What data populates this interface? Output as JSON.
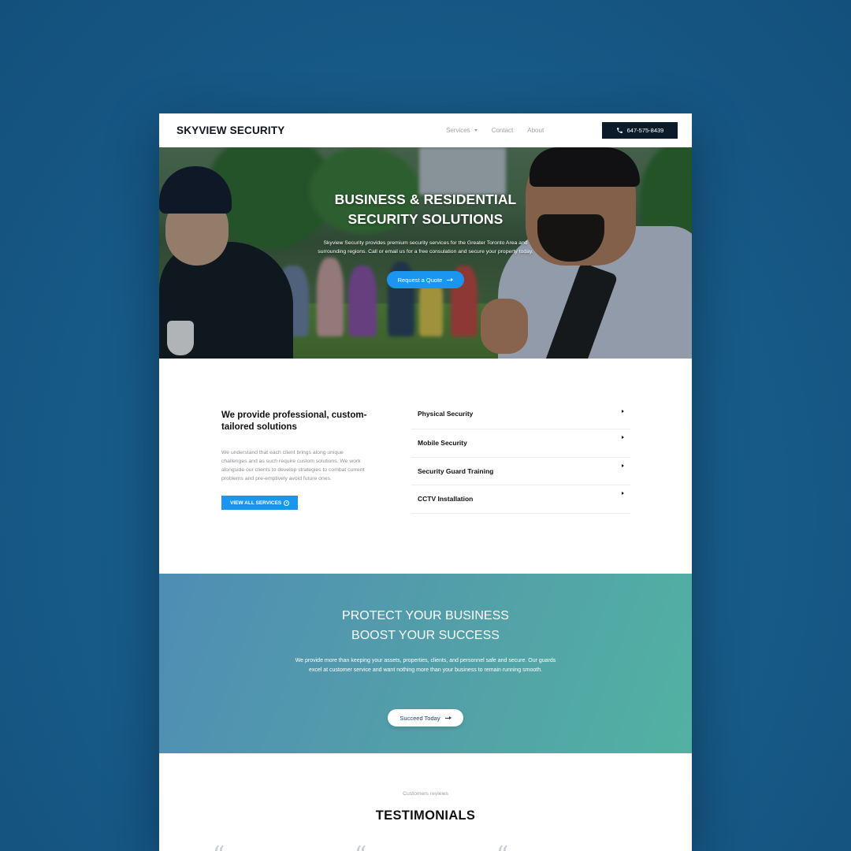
{
  "nav": {
    "brand": "SKYVIEW SECURITY",
    "menu": [
      {
        "label": "Services",
        "has_dropdown": true
      },
      {
        "label": "Contact",
        "has_dropdown": false
      },
      {
        "label": "About",
        "has_dropdown": false
      }
    ],
    "phone": "647-575-8439"
  },
  "hero": {
    "title_line1": "BUSINESS & RESIDENTIAL",
    "title_line2": "SECURITY SOLUTIONS",
    "text_line1": "Skyview Security provides premium security services for the Greater Toronto Area and",
    "text_line2": "surrounding regions. Call or email us for a free consulation and secure your property today.",
    "button": "Request a Quote"
  },
  "services": {
    "heading_line1": "We provide professional, custom-",
    "heading_line2": "tailored solutions",
    "paragraph_lines": [
      "We understand that each client brings along unique",
      "challenges and as such require custom solutions. We work",
      "alongside our clients to develop strategies to combat current",
      "problems and pre-emptively avoid future ones."
    ],
    "button": "VIEW ALL SERVICES",
    "items": [
      "Physical Security",
      "Mobile Security",
      "Security Guard Training",
      "CCTV Installation"
    ]
  },
  "protect": {
    "line1": "PROTECT YOUR BUSINESS",
    "line2": "BOOST YOUR SUCCESS",
    "text_line1": "We provide more than keeping your assets, properties, clients, and personnel safe and secure. Our guards",
    "text_line2": "excel at customer service and want nothing more than your business to remain running smooth.",
    "button": "Succeed Today"
  },
  "testimonials": {
    "subtitle": "Customers reviews",
    "title": "TESTIMONIALS",
    "quote_glyph": "“"
  },
  "colors": {
    "background": "#1a5f8f",
    "accent_blue": "#1a95f0",
    "dark_navy": "#0c1b2a",
    "gradient_start": "#4f8db5",
    "gradient_end": "#52b2a2"
  }
}
